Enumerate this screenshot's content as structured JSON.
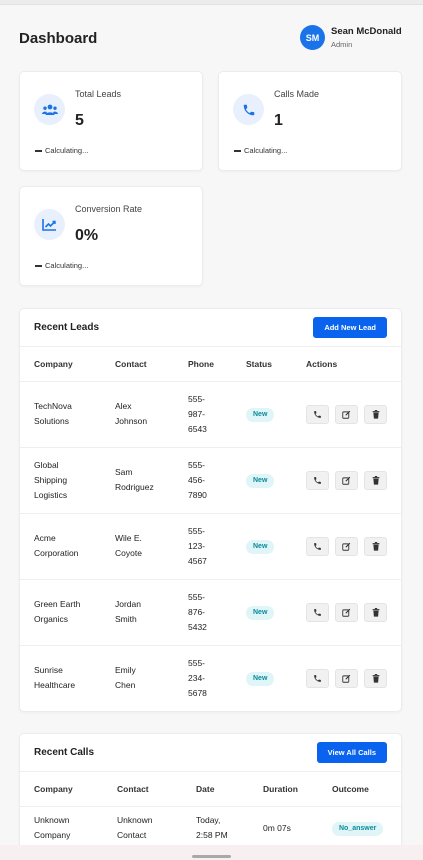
{
  "header": {
    "title": "Dashboard",
    "user": {
      "initials": "SM",
      "name": "Sean McDonald",
      "role": "Admin"
    }
  },
  "stats": [
    {
      "label": "Total Leads",
      "value": "5",
      "trend": "Calculating...",
      "icon": "users-icon"
    },
    {
      "label": "Calls Made",
      "value": "1",
      "trend": "Calculating...",
      "icon": "phone-icon"
    },
    {
      "label": "Conversion Rate",
      "value": "0%",
      "trend": "Calculating...",
      "icon": "chart-line-icon"
    }
  ],
  "recent_leads": {
    "title": "Recent Leads",
    "add_button": "Add New Lead",
    "columns": [
      "Company",
      "Contact",
      "Phone",
      "Status",
      "Actions"
    ],
    "rows": [
      {
        "company": [
          "TechNova",
          "Solutions"
        ],
        "contact": [
          "Alex",
          "Johnson"
        ],
        "phone": [
          "555-",
          "987-",
          "6543"
        ],
        "status": "New"
      },
      {
        "company": [
          "Global",
          "Shipping",
          "Logistics"
        ],
        "contact": [
          "Sam",
          "Rodriguez"
        ],
        "phone": [
          "555-",
          "456-",
          "7890"
        ],
        "status": "New"
      },
      {
        "company": [
          "Acme",
          "Corporation"
        ],
        "contact": [
          "Wile E.",
          "Coyote"
        ],
        "phone": [
          "555-",
          "123-",
          "4567"
        ],
        "status": "New"
      },
      {
        "company": [
          "Green Earth",
          "Organics"
        ],
        "contact": [
          "Jordan",
          "Smith"
        ],
        "phone": [
          "555-",
          "876-",
          "5432"
        ],
        "status": "New"
      },
      {
        "company": [
          "Sunrise",
          "Healthcare"
        ],
        "contact": [
          "Emily",
          "Chen"
        ],
        "phone": [
          "555-",
          "234-",
          "5678"
        ],
        "status": "New"
      }
    ]
  },
  "recent_calls": {
    "title": "Recent Calls",
    "view_button": "View All Calls",
    "columns": [
      "Company",
      "Contact",
      "Date",
      "Duration",
      "Outcome"
    ],
    "rows": [
      {
        "company": [
          "Unknown",
          "Company"
        ],
        "contact": [
          "Unknown",
          "Contact"
        ],
        "date": [
          "Today,",
          "2:58 PM"
        ],
        "duration": "0m 07s",
        "outcome": "No_answer"
      }
    ]
  },
  "colors": {
    "accent": "#0a63ef",
    "avatar": "#1a73e8",
    "badge_text": "#0b8a9a",
    "badge_bg": "#dff5f7"
  }
}
